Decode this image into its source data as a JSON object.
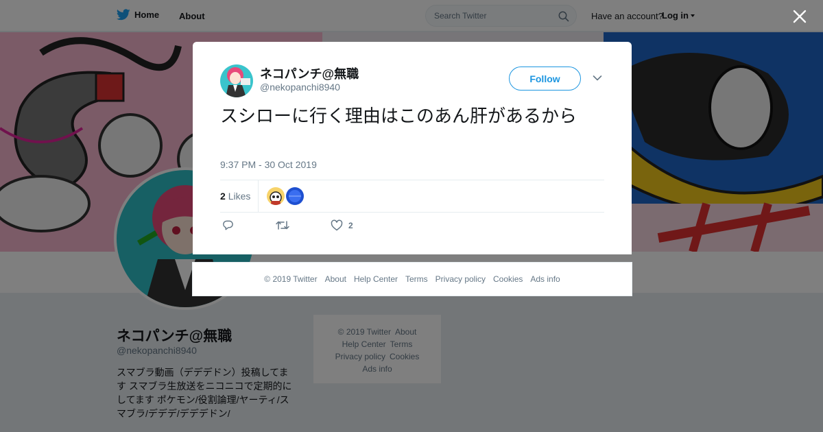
{
  "topbar": {
    "home_label": "Home",
    "about_label": "About",
    "search_placeholder": "Search Twitter",
    "have_account": "Have an account?",
    "login_label": "Log in"
  },
  "profile": {
    "name": "ネコパンチ@無職",
    "handle": "@nekopanchi8940",
    "bio": "スマブラ動画（デデデドン）投稿してます スマブラ生放送をニコニコで定期的にしてます ポケモン/役割論理/ヤーティ/スマブラ/デデデ/デデデドン/"
  },
  "side_footer": {
    "items": [
      "© 2019 Twitter",
      "About",
      "Help Center",
      "Terms",
      "Privacy policy",
      "Cookies",
      "Ads info"
    ]
  },
  "tweet": {
    "author_name": "ネコパンチ@無職",
    "author_handle": "@nekopanchi8940",
    "follow_label": "Follow",
    "text": "スシローに行く理由はこのあん肝があるから",
    "timestamp": "9:37 PM - 30 Oct 2019",
    "likes_count": "2",
    "likes_label": "Likes",
    "like_action_count": "2"
  },
  "modal_footer": {
    "items": [
      "© 2019 Twitter",
      "About",
      "Help Center",
      "Terms",
      "Privacy policy",
      "Cookies",
      "Ads info"
    ]
  },
  "colors": {
    "twitter_blue": "#1da1f2",
    "link_blue": "#1b95e0",
    "muted": "#657786",
    "overlay": "rgba(0,0,0,0.5)"
  },
  "icons": {
    "logo": "twitter-bird-icon",
    "search": "search-icon",
    "close": "close-icon",
    "reply": "reply-icon",
    "retweet": "retweet-icon",
    "like": "heart-icon",
    "more": "chevron-down-icon"
  }
}
